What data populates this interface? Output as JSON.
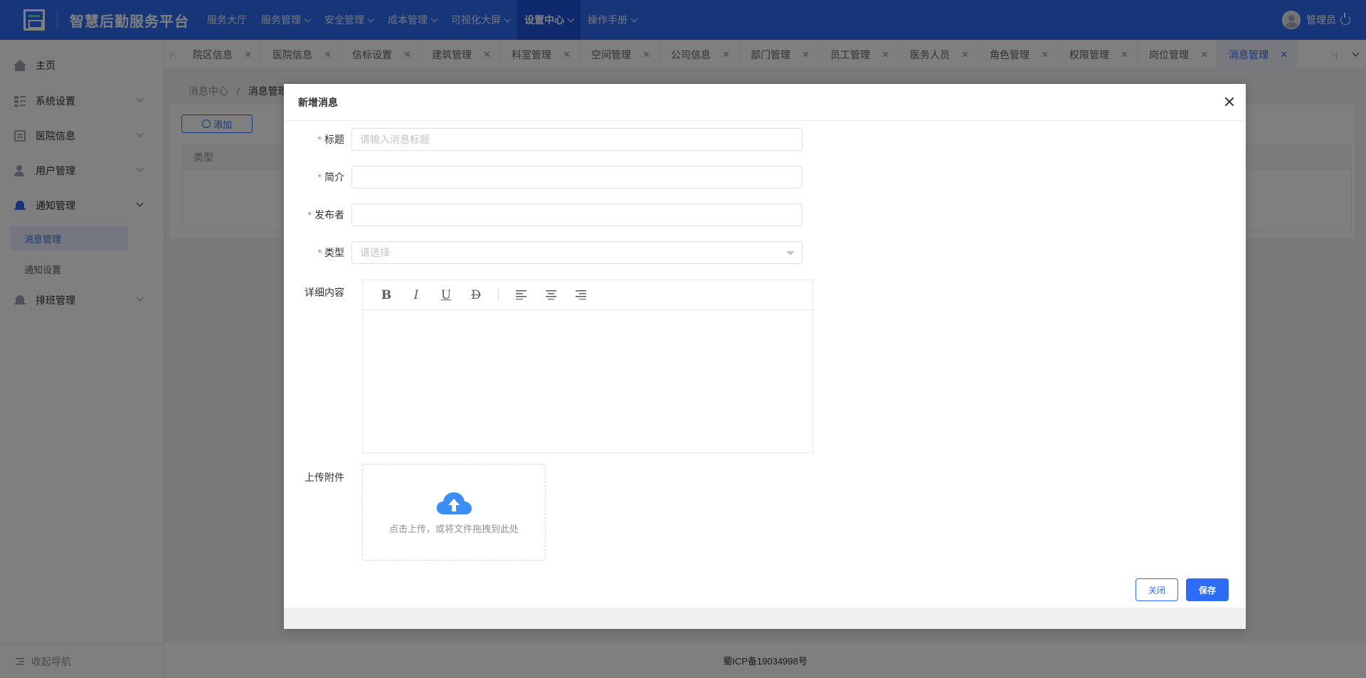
{
  "app": {
    "title": "智慧后勤服务平台"
  },
  "topnav": [
    {
      "label": "服务大厅",
      "has_dropdown": false
    },
    {
      "label": "服务管理",
      "has_dropdown": true
    },
    {
      "label": "安全管理",
      "has_dropdown": true
    },
    {
      "label": "成本管理",
      "has_dropdown": true
    },
    {
      "label": "可视化大屏",
      "has_dropdown": true
    },
    {
      "label": "设置中心",
      "has_dropdown": true,
      "active": true
    },
    {
      "label": "操作手册",
      "has_dropdown": true
    }
  ],
  "user": {
    "name": "管理员"
  },
  "sidebar": {
    "items": [
      {
        "label": "主页",
        "icon": "home-icon"
      },
      {
        "label": "系统设置",
        "icon": "grid-icon"
      },
      {
        "label": "医院信息",
        "icon": "document-icon"
      },
      {
        "label": "用户管理",
        "icon": "user-icon"
      },
      {
        "label": "通知管理",
        "icon": "bell-icon",
        "expanded": true
      },
      {
        "label": "排班管理",
        "icon": "bell-icon"
      }
    ],
    "sub_items": [
      {
        "label": "消息管理",
        "active": true
      },
      {
        "label": "通知设置"
      }
    ],
    "collapse_label": "收起导航"
  },
  "tabs": [
    {
      "label": "院区信息"
    },
    {
      "label": "医院信息"
    },
    {
      "label": "信标设置"
    },
    {
      "label": "建筑管理"
    },
    {
      "label": "科室管理"
    },
    {
      "label": "空间管理"
    },
    {
      "label": "公司信息"
    },
    {
      "label": "部门管理"
    },
    {
      "label": "员工管理"
    },
    {
      "label": "医务人员"
    },
    {
      "label": "角色管理"
    },
    {
      "label": "权限管理"
    },
    {
      "label": "岗位管理"
    },
    {
      "label": "消息管理",
      "active": true
    }
  ],
  "breadcrumb": {
    "parent": "消息中心",
    "separator": "/",
    "current": "消息管理"
  },
  "page": {
    "add_label": "添加",
    "table_header_type": "类型"
  },
  "footer": {
    "icp": "蜀ICP备19034998号"
  },
  "dialog": {
    "title": "新增消息",
    "fields": {
      "title": {
        "label": "标题",
        "required": true,
        "value": "",
        "placeholder": "请输入消息标题"
      },
      "summary": {
        "label": "简介",
        "required": true,
        "value": "",
        "placeholder": ""
      },
      "publisher": {
        "label": "发布者",
        "required": true,
        "value": "",
        "placeholder": ""
      },
      "type": {
        "label": "类型",
        "required": true,
        "placeholder": "请选择"
      },
      "detail": {
        "label": "详细内容"
      },
      "attachment": {
        "label": "上传附件",
        "hint": "点击上传，或将文件拖拽到此处"
      }
    },
    "toolbar": {
      "bold": "B",
      "italic": "I",
      "underline": "U",
      "strike": "D"
    },
    "buttons": {
      "close": "关闭",
      "save": "保存"
    }
  },
  "colors": {
    "primary": "#2f6cf5",
    "required": "#f56c6c",
    "topbar_active": "#1f55d8"
  }
}
